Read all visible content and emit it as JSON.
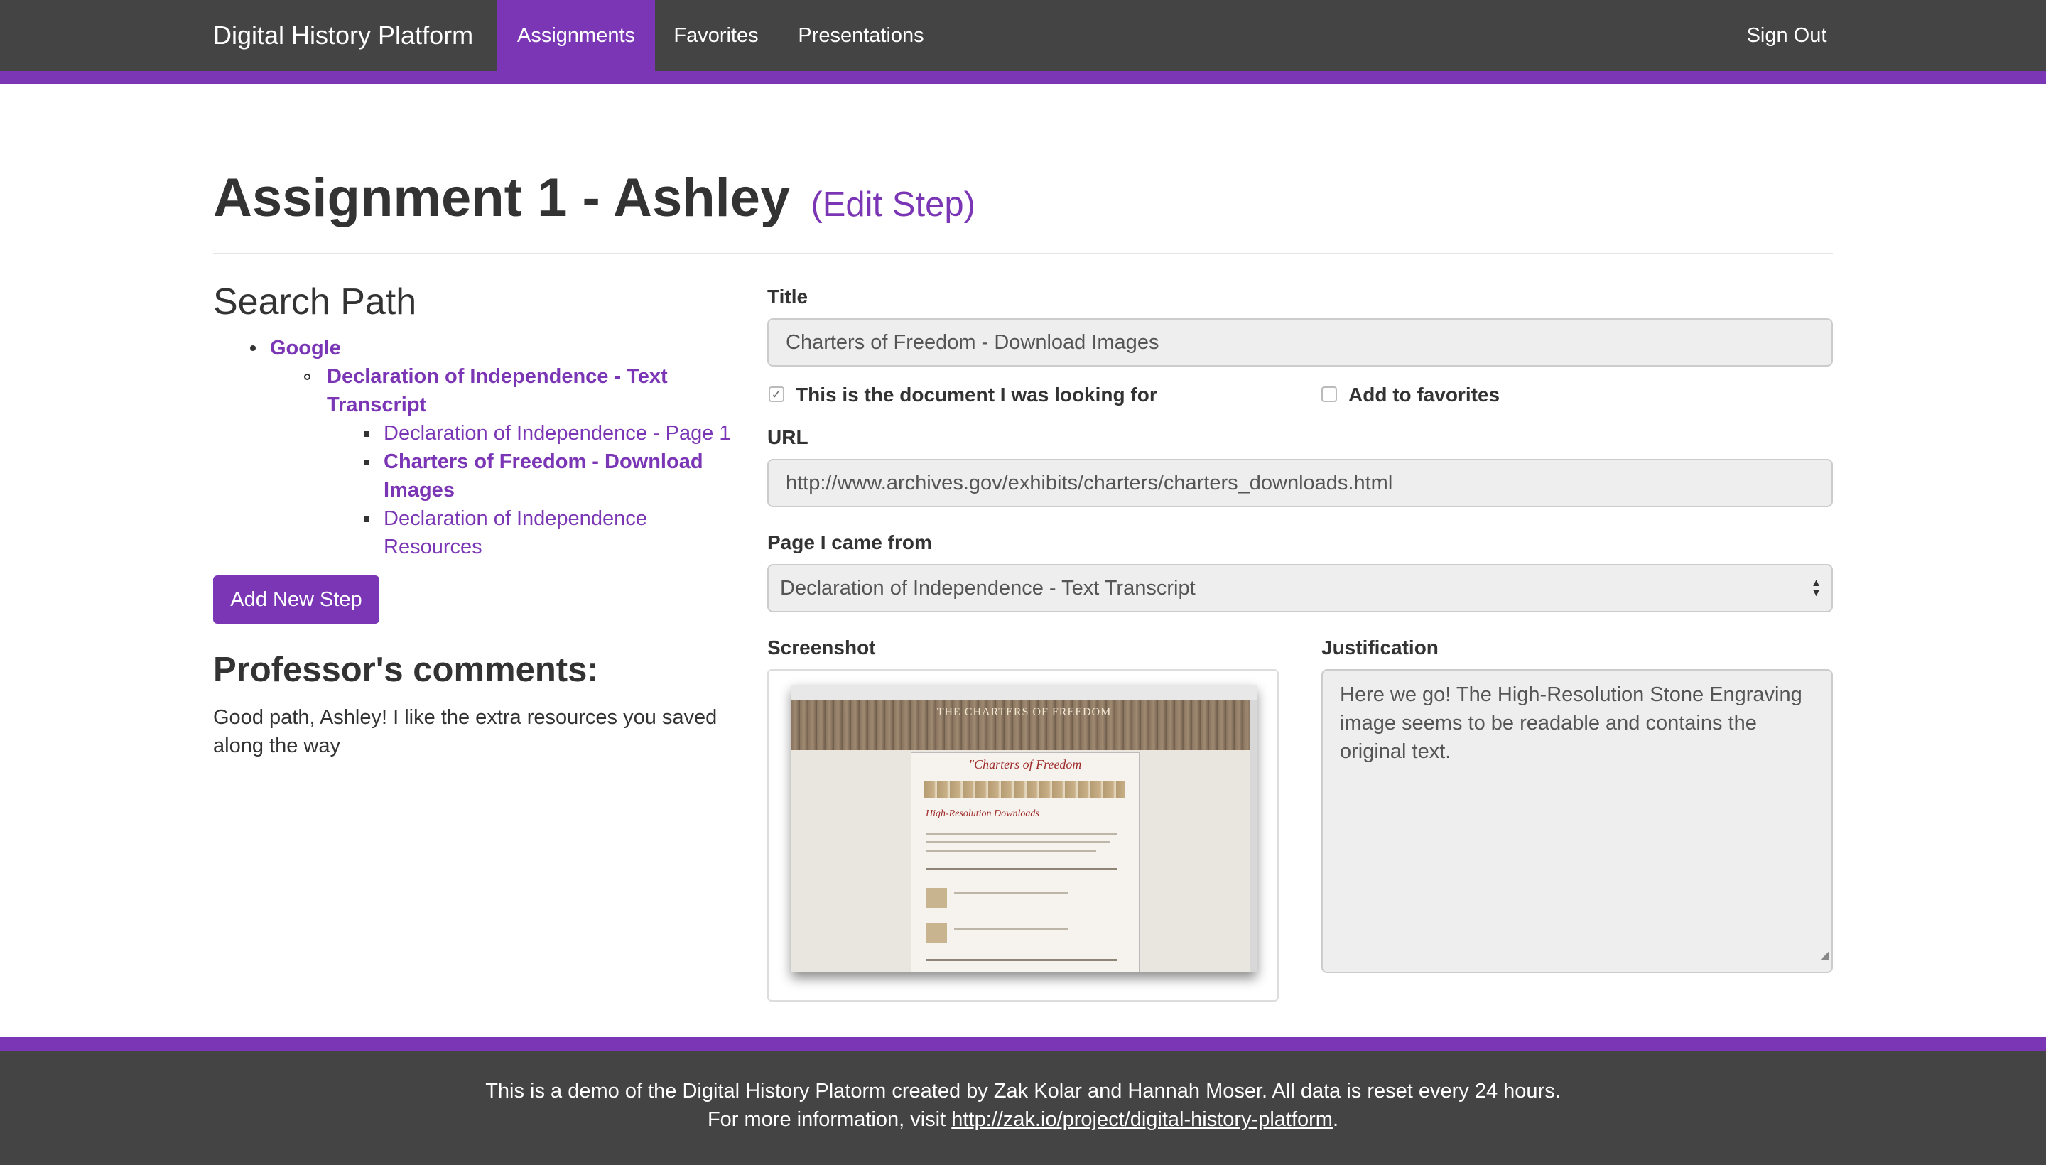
{
  "nav": {
    "brand": "Digital History Platform",
    "assignments": "Assignments",
    "favorites": "Favorites",
    "presentations": "Presentations",
    "sign_out": "Sign Out",
    "accent_color": "#7b36b5"
  },
  "header": {
    "title": "Assignment 1 - Ashley",
    "edit_link": "(Edit Step)"
  },
  "search_path": {
    "heading": "Search Path",
    "level1": "Google",
    "level2_line1": "Declaration of Independence - Text",
    "level2_line2": "Transcript",
    "level3_item1": "Declaration of Independence - Page 1",
    "level3_item2_line1": "Charters of Freedom - Download",
    "level3_item2_line2": "Images",
    "level3_item3_line1": "Declaration of Independence",
    "level3_item3_line2": "Resources",
    "add_button": "Add New Step"
  },
  "comments": {
    "heading": "Professor's comments:",
    "text": "Good path, Ashley! I like the extra resources you saved along the way"
  },
  "form": {
    "title_label": "Title",
    "title_value": "Charters of Freedom - Download Images",
    "doc_checkbox_label": "This is the document I was looking for",
    "doc_checkbox_checked": true,
    "fav_checkbox_label": "Add to favorites",
    "fav_checkbox_checked": false,
    "check_mark": "✓",
    "url_label": "URL",
    "url_value": "http://www.archives.gov/exhibits/charters/charters_downloads.html",
    "came_from_label": "Page I came from",
    "came_from_value": "Declaration of Independence - Text Transcript",
    "screenshot_label": "Screenshot",
    "justification_label": "Justification",
    "justification_value": "Here we go! The High-Resolution Stone Engraving image seems to be readable and contains the original text."
  },
  "screenshot_preview": {
    "banner_text": "THE CHARTERS OF FREEDOM",
    "page_title": "\"Charters of Freedom",
    "page_subtitle": "High-Resolution Downloads"
  },
  "footer": {
    "line1": "This is a demo of the Digital History Platorm created by Zak Kolar and Hannah Moser. All data is reset every 24 hours.",
    "line2_prefix": "For more information, visit ",
    "line2_link": "http://zak.io/project/digital-history-platform",
    "line2_suffix": "."
  }
}
